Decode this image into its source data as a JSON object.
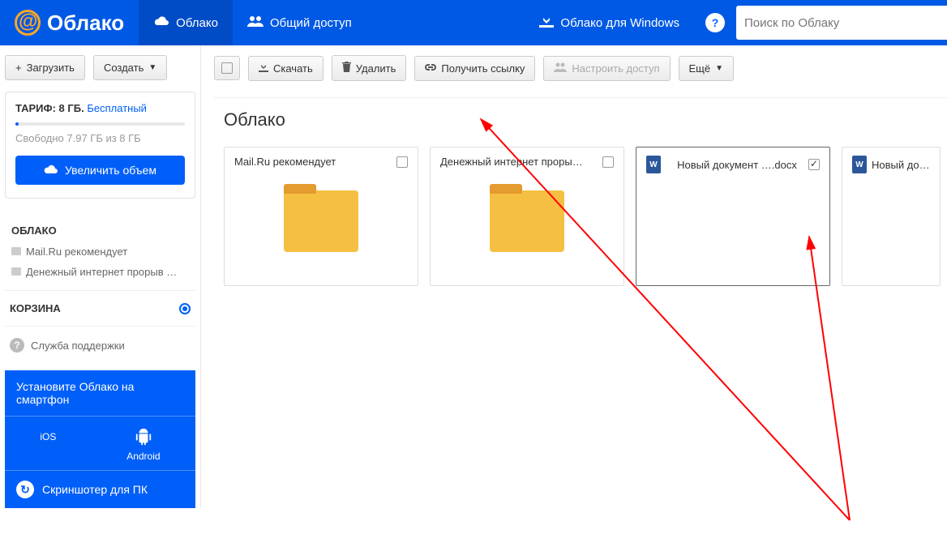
{
  "header": {
    "logo_text": "Облако",
    "tab_cloud": "Облако",
    "tab_shared": "Общий доступ",
    "cloud_for_windows": "Облако для Windows",
    "search_placeholder": "Поиск по Облаку"
  },
  "sidebar": {
    "upload_label": "Загрузить",
    "create_label": "Создать",
    "tariff_label": "ТАРИФ: 8 ГБ.",
    "tariff_plan": "Бесплатный",
    "free_space": "Свободно 7.97 ГБ из 8 ГБ",
    "upgrade_label": "Увеличить объем",
    "section_cloud": "ОБЛАКО",
    "items": [
      {
        "label": "Mail.Ru рекомендует"
      },
      {
        "label": "Денежный интернет прорыв …"
      }
    ],
    "trash_label": "КОРЗИНА",
    "support_label": "Служба поддержки",
    "promo_head": "Установите Облако на смартфон",
    "platform_ios": "iOS",
    "platform_android": "Android",
    "screenshoter": "Скриншотер для ПК"
  },
  "toolbar": {
    "download": "Скачать",
    "delete": "Удалить",
    "get_link": "Получить ссылку",
    "configure_access": "Настроить доступ",
    "more": "Ещё"
  },
  "main": {
    "title": "Облако",
    "files": [
      {
        "name": "Mail.Ru рекомендует",
        "type": "folder",
        "checked": false
      },
      {
        "name": "Денежный интернет проры…",
        "type": "folder",
        "checked": false
      },
      {
        "name": "Новый документ ….docx",
        "type": "docx",
        "checked": true
      },
      {
        "name": "Новый докумен",
        "type": "docx",
        "checked": false
      }
    ]
  }
}
